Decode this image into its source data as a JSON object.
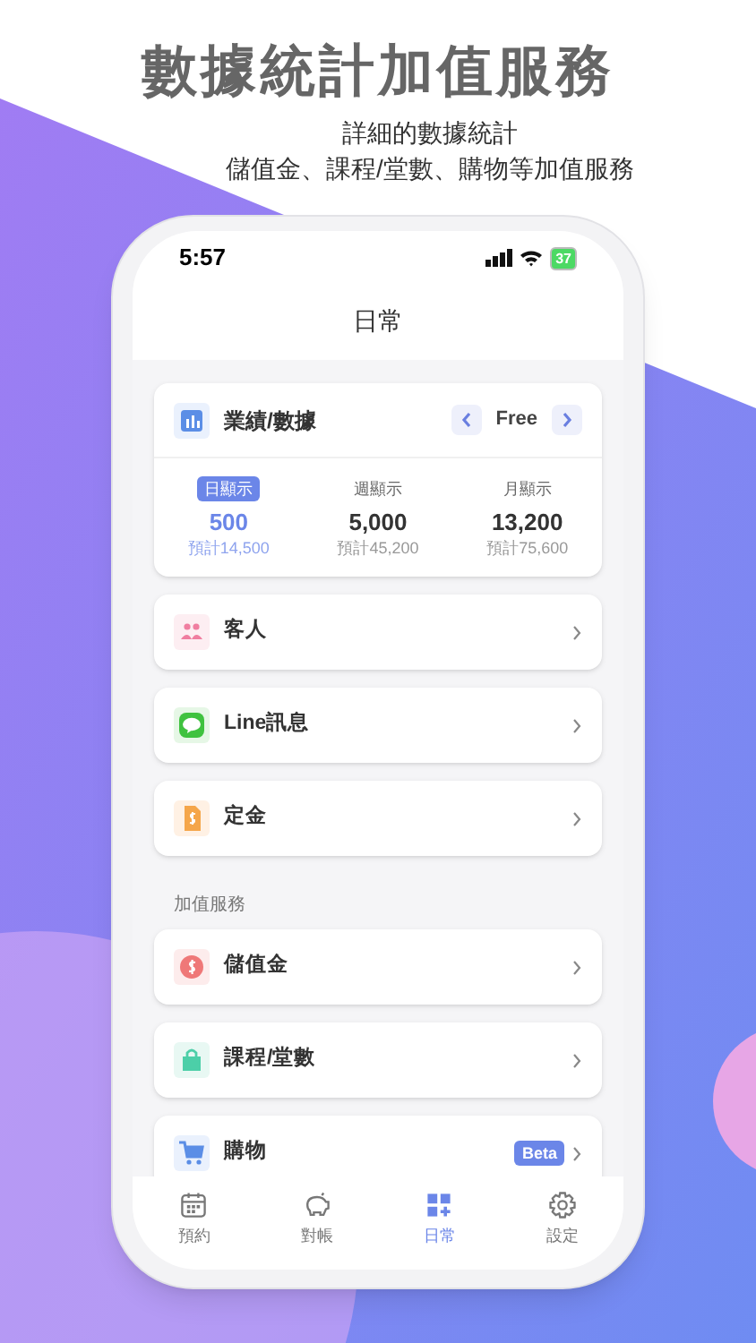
{
  "headline": "數據統計加值服務",
  "subtitle_lines": [
    "詳細的數據統計",
    "儲值金、課程/堂數、購物等加值服務"
  ],
  "status_bar": {
    "time": "5:57",
    "battery": "37"
  },
  "nav_title": "日常",
  "stats_card": {
    "title": "業績/數據",
    "plan": "Free",
    "periods": [
      {
        "label": "日顯示",
        "value": "500",
        "forecast": "預計14,500",
        "selected": true
      },
      {
        "label": "週顯示",
        "value": "5,000",
        "forecast": "預計45,200",
        "selected": false
      },
      {
        "label": "月顯示",
        "value": "13,200",
        "forecast": "預計75,600",
        "selected": false
      }
    ]
  },
  "menu_items": [
    {
      "kind": "people",
      "label": "客人"
    },
    {
      "kind": "chat",
      "label": "Line訊息"
    },
    {
      "kind": "deposit",
      "label": "定金"
    }
  ],
  "section_title": "加值服務",
  "service_items": [
    {
      "kind": "coin",
      "label": "儲值金"
    },
    {
      "kind": "bag",
      "label": "課程/堂數"
    },
    {
      "kind": "cart",
      "label": "購物",
      "badge": "Beta"
    }
  ],
  "tab_bar": [
    {
      "kind": "calendar",
      "label": "預約",
      "selected": false
    },
    {
      "kind": "piggy",
      "label": "對帳",
      "selected": false
    },
    {
      "kind": "grid",
      "label": "日常",
      "selected": true
    },
    {
      "kind": "gear",
      "label": "設定",
      "selected": false
    }
  ]
}
